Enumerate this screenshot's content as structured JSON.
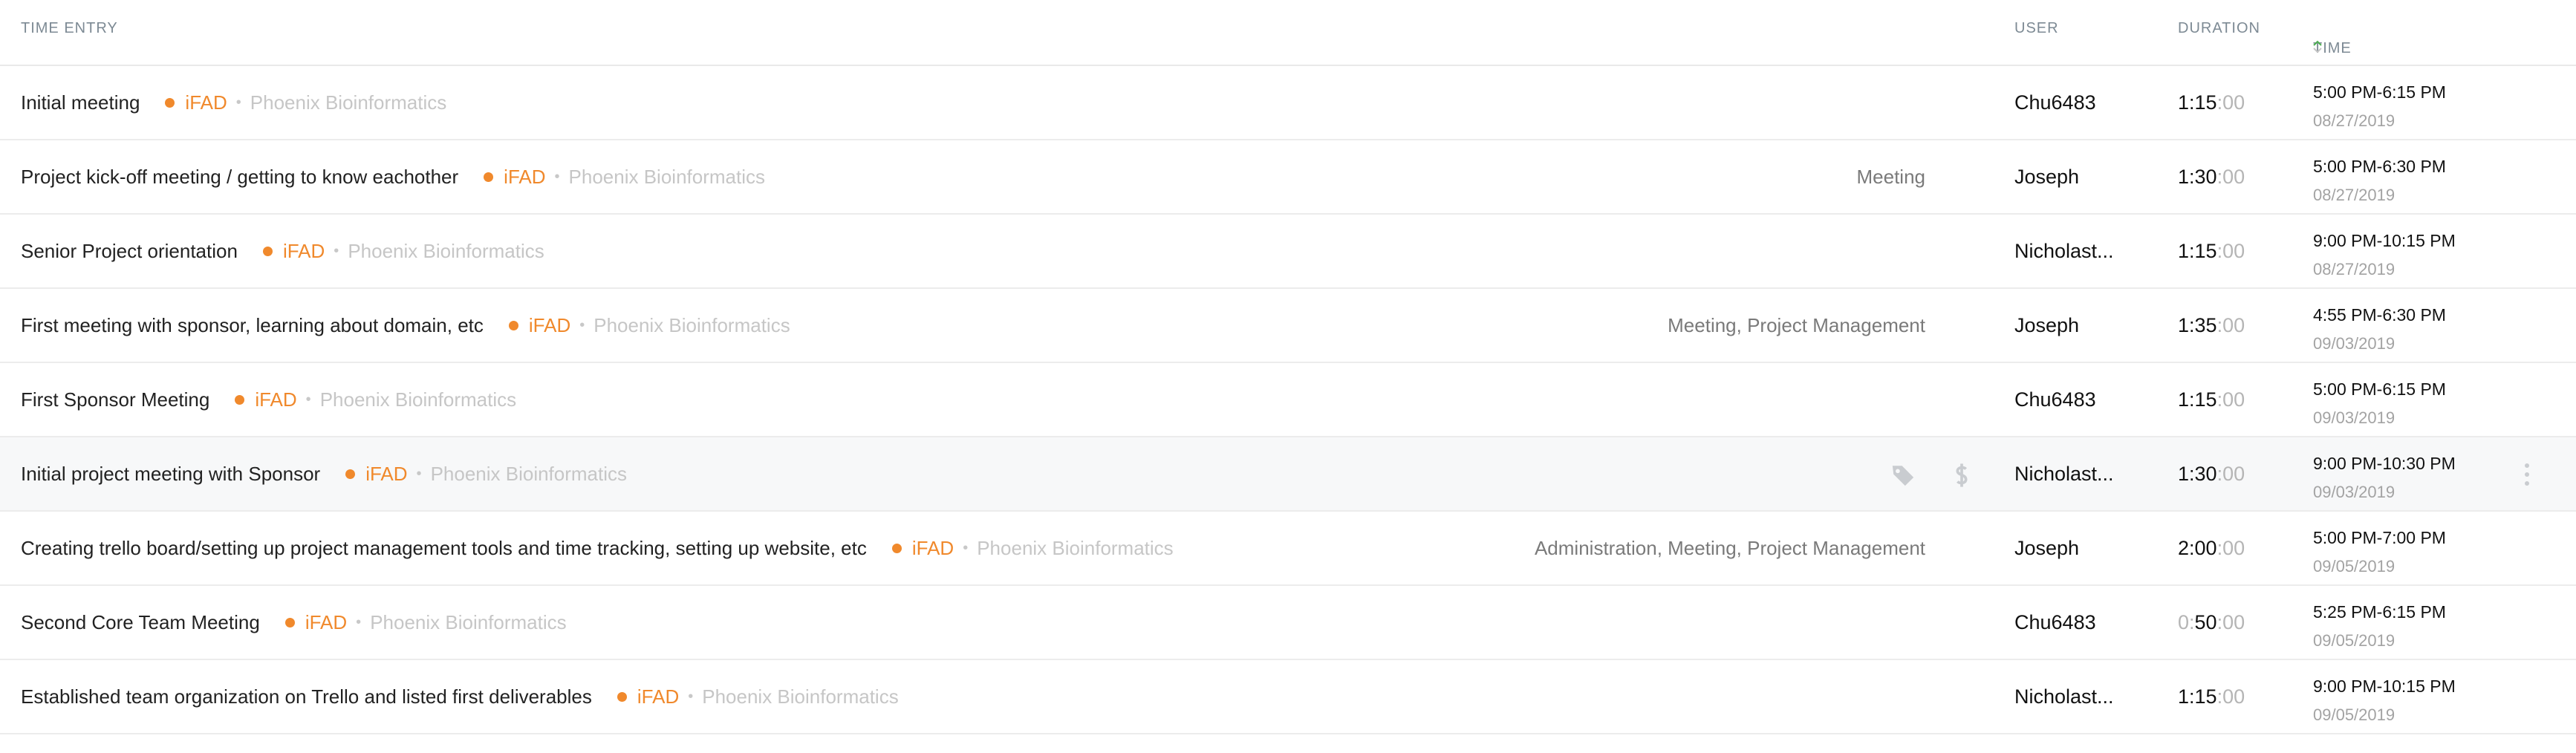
{
  "header": {
    "time_entry": "TIME ENTRY",
    "user": "USER",
    "duration": "DURATION",
    "time": "TIME"
  },
  "colors": {
    "project": "#f0892c",
    "sort_arrow": "#4caf50"
  },
  "icons": {
    "sort": "sort-arrows-icon",
    "tag": "tag-icon",
    "billable": "dollar-icon",
    "more": "vertical-dots-icon"
  },
  "entries": [
    {
      "description": "Initial meeting",
      "project": "iFAD",
      "client": "Phoenix Bioinformatics",
      "tags": "",
      "user": "Chu6483",
      "dur_h": "1:15",
      "dur_s": ":00",
      "time": "5:00 PM-6:15 PM",
      "date": "08/27/2019"
    },
    {
      "description": "Project kick-off meeting / getting to know eachother",
      "project": "iFAD",
      "client": "Phoenix Bioinformatics",
      "tags": "Meeting",
      "user": "Joseph",
      "dur_h": "1:30",
      "dur_s": ":00",
      "time": "5:00 PM-6:30 PM",
      "date": "08/27/2019"
    },
    {
      "description": "Senior Project orientation",
      "project": "iFAD",
      "client": "Phoenix Bioinformatics",
      "tags": "",
      "user": "Nicholast...",
      "dur_h": "1:15",
      "dur_s": ":00",
      "time": "9:00 PM-10:15 PM",
      "date": "08/27/2019"
    },
    {
      "description": "First meeting with sponsor, learning about domain, etc",
      "project": "iFAD",
      "client": "Phoenix Bioinformatics",
      "tags": "Meeting, Project Management",
      "user": "Joseph",
      "dur_h": "1:35",
      "dur_s": ":00",
      "time": "4:55 PM-6:30 PM",
      "date": "09/03/2019"
    },
    {
      "description": "First Sponsor Meeting",
      "project": "iFAD",
      "client": "Phoenix Bioinformatics",
      "tags": "",
      "user": "Chu6483",
      "dur_h": "1:15",
      "dur_s": ":00",
      "time": "5:00 PM-6:15 PM",
      "date": "09/03/2019"
    },
    {
      "description": "Initial project meeting with Sponsor",
      "project": "iFAD",
      "client": "Phoenix Bioinformatics",
      "tags": "",
      "user": "Nicholast...",
      "dur_h": "1:30",
      "dur_s": ":00",
      "time": "9:00 PM-10:30 PM",
      "date": "09/03/2019"
    },
    {
      "description": "Creating trello board/setting up project management tools and time tracking, setting up website, etc",
      "project": "iFAD",
      "client": "Phoenix Bioinformatics",
      "tags": "Administration, Meeting, Project Management",
      "user": "Joseph",
      "dur_h": "2:00",
      "dur_s": ":00",
      "time": "5:00 PM-7:00 PM",
      "date": "09/05/2019"
    },
    {
      "description": "Second Core Team Meeting",
      "project": "iFAD",
      "client": "Phoenix Bioinformatics",
      "tags": "",
      "user": "Chu6483",
      "dur_pre": "0:",
      "dur_h": "50",
      "dur_s": ":00",
      "time": "5:25 PM-6:15 PM",
      "date": "09/05/2019"
    },
    {
      "description": "Established team organization on Trello and listed first deliverables",
      "project": "iFAD",
      "client": "Phoenix Bioinformatics",
      "tags": "",
      "user": "Nicholast...",
      "dur_h": "1:15",
      "dur_s": ":00",
      "time": "9:00 PM-10:15 PM",
      "date": "09/05/2019"
    }
  ]
}
